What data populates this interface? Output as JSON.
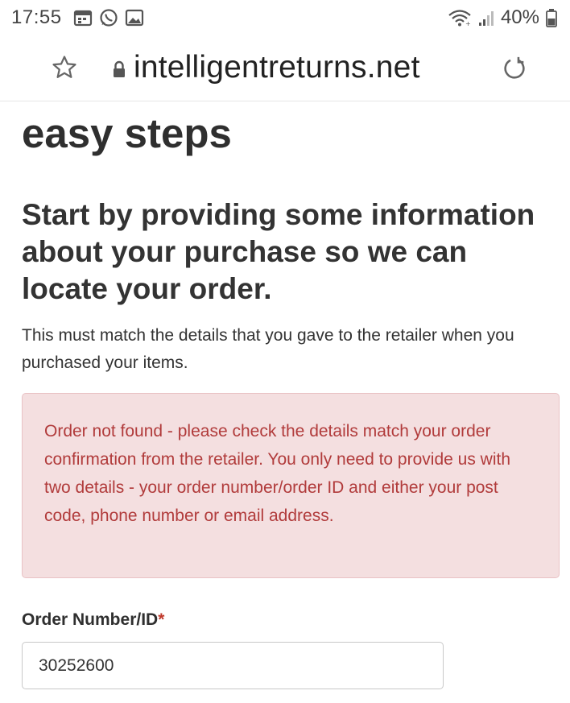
{
  "status_bar": {
    "time": "17:55",
    "battery": "40%",
    "icons": [
      "calendar-icon",
      "whatsapp-icon",
      "gallery-icon",
      "wifi-icon",
      "signal-icon",
      "battery-icon"
    ]
  },
  "browser": {
    "url": "intelligentreturns.net",
    "icons": [
      "star-icon",
      "lock-icon",
      "reload-icon"
    ]
  },
  "page": {
    "heading": "easy steps",
    "subheading": "Start by providing some information about your purchase so we can locate your order.",
    "description": "This must match the details that you gave to the retailer when you purchased your items.",
    "error_message": "Order not found - please check the details match your order confirmation from the retailer. You only need to provide us with two details - your order number/order ID and either your post code, phone number or email address.",
    "order_field": {
      "label": "Order Number/ID",
      "required_mark": "*",
      "value": "30252600"
    }
  },
  "colors": {
    "error_text": "#b13b3b",
    "error_bg": "#f4dfe0",
    "required": "#c0392b"
  }
}
